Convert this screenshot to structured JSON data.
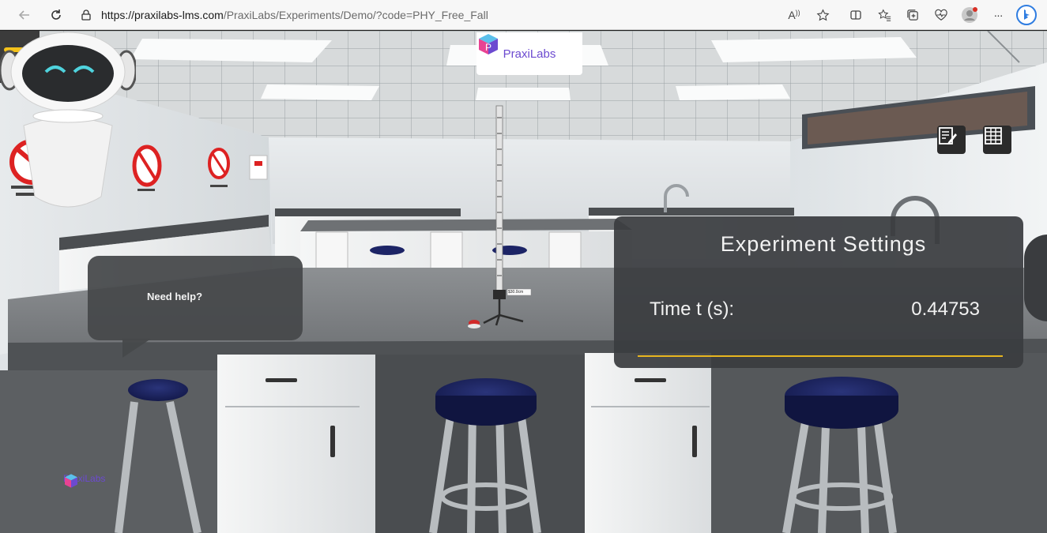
{
  "browser": {
    "url_host": "https://praxilabs-lms.com",
    "url_path": "/PraxiLabs/Experiments/Demo/?code=PHY_Free_Fall",
    "icons": [
      "back-icon",
      "refresh-icon",
      "lock-icon",
      "read-aloud-icon",
      "favorite-star-icon",
      "split-screen-icon",
      "favorites-icon",
      "collections-icon",
      "performance-icon",
      "profile-icon",
      "more-icon",
      "bing-icon"
    ],
    "read_aloud_label": "A",
    "more_label": "···"
  },
  "app": {
    "brand": "PraxiLabs",
    "help": {
      "text": "Need help?"
    },
    "settings": {
      "title": "Experiment Settings",
      "time_label": "Time t (s):",
      "time_value": "0.44753"
    },
    "stand_label": "$30.0cm",
    "robot_brand": "PraxiLabs",
    "tools": [
      "notes-icon",
      "data-table-icon"
    ]
  },
  "colors": {
    "accent": "#f4c21b",
    "panel_bg": "#3a3c3f",
    "underline": "#e7b51f",
    "brand": "#6c4ad0",
    "stool_seat": "#1c2466"
  }
}
